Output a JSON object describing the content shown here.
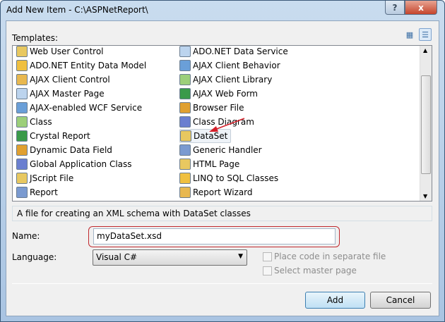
{
  "window": {
    "title": "Add New Item - C:\\ASPNetReport\\",
    "help": "?",
    "close": "x"
  },
  "templates_label": "Templates:",
  "view_buttons": {
    "large_icons": "large-icons-view",
    "small_icons": "list-view"
  },
  "templates": {
    "col1": [
      "Web User Control",
      "ADO.NET Entity Data Model",
      "AJAX Client Control",
      "AJAX Master Page",
      "AJAX-enabled WCF Service",
      "Class",
      "Crystal Report",
      "Dynamic Data Field",
      "Global Application Class",
      "JScript File",
      "Report"
    ],
    "col2": [
      "ADO.NET Data Service",
      "AJAX Client Behavior",
      "AJAX Client Library",
      "AJAX Web Form",
      "Browser File",
      "Class Diagram",
      "DataSet",
      "Generic Handler",
      "HTML Page",
      "LINQ to SQL Classes",
      "Report Wizard"
    ],
    "selected": "DataSet"
  },
  "description": "A file for creating an XML schema with DataSet classes",
  "name_label": "Name:",
  "name_value": "myDataSet.xsd",
  "language_label": "Language:",
  "language_value": "Visual C#",
  "place_code_label": "Place code in separate file",
  "master_page_label": "Select master page",
  "add_label": "Add",
  "cancel_label": "Cancel",
  "colors": {
    "annotation": "#d4202a",
    "accent": "#3c7fb1"
  }
}
